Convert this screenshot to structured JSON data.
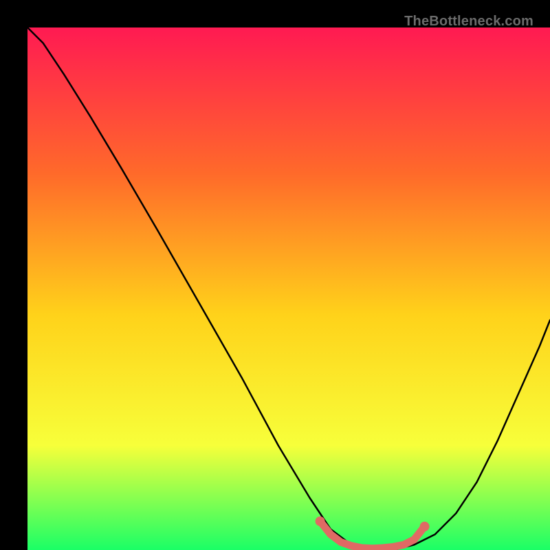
{
  "watermark": "TheBottleneck.com",
  "colors": {
    "background": "#000000",
    "gradient_top": "#ff1a52",
    "gradient_mid_upper": "#ff6a2a",
    "gradient_mid": "#ffd21a",
    "gradient_mid_lower": "#f7ff3a",
    "gradient_bottom": "#1aff66",
    "curve": "#000000",
    "highlight": "#e06a64"
  },
  "chart_data": {
    "type": "line",
    "title": "",
    "xlabel": "",
    "ylabel": "",
    "xlim": [
      0,
      100
    ],
    "ylim": [
      0,
      100
    ],
    "series": [
      {
        "name": "bottleneck-curve",
        "x": [
          0,
          3,
          7,
          12,
          18,
          25,
          33,
          41,
          48,
          54,
          58,
          62,
          66,
          70,
          74,
          78,
          82,
          86,
          90,
          94,
          98,
          100
        ],
        "y": [
          100,
          97,
          91,
          83,
          73,
          61,
          47,
          33,
          20,
          10,
          4,
          1,
          0,
          0,
          1,
          3,
          7,
          13,
          21,
          30,
          39,
          44
        ]
      },
      {
        "name": "sweet-spot",
        "x": [
          56,
          58,
          60,
          62,
          64,
          66,
          68,
          70,
          72,
          74,
          76
        ],
        "y": [
          5.5,
          3.0,
          1.5,
          0.8,
          0.4,
          0.3,
          0.4,
          0.6,
          1.0,
          2.0,
          4.5
        ]
      }
    ],
    "annotations": []
  }
}
